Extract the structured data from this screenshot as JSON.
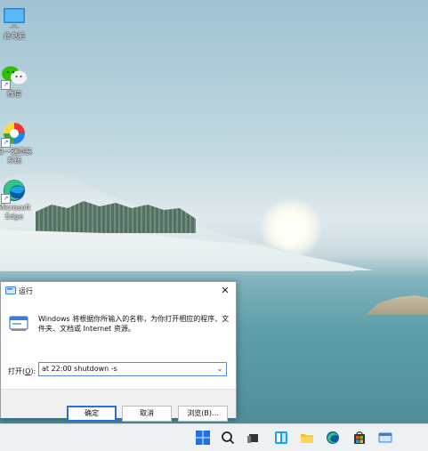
{
  "desktop": {
    "icons": [
      {
        "label": "此电脑"
      },
      {
        "label": "微信"
      },
      {
        "label": "白一键重装",
        "label2": "系统"
      },
      {
        "label": "Microsoft",
        "label2": "Edge"
      }
    ]
  },
  "run_dialog": {
    "title": "运行",
    "description": "Windows 将根据你所输入的名称，为你打开相应的程序、文件夹、文档或 Internet 资源。",
    "open_label_prefix": "打开(",
    "open_label_key": "O",
    "open_label_suffix": "):",
    "input_value": "at 22:00 shutdown -s",
    "ok_label": "确定",
    "cancel_label": "取消",
    "browse_label": "浏览(B)..."
  },
  "taskbar": {
    "icons": [
      "start-icon",
      "search-icon",
      "task-view-icon",
      "widgets-icon",
      "file-explorer-icon",
      "edge-icon",
      "store-icon",
      "run-icon"
    ]
  },
  "colors": {
    "accent": "#2a6fd6",
    "taskbar": "#eef1f4"
  }
}
